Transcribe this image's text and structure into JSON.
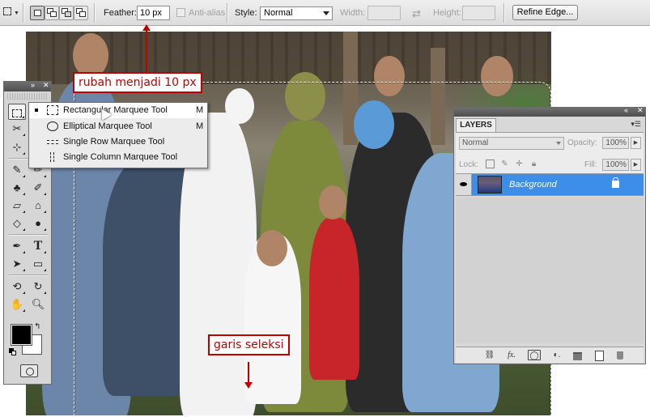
{
  "options_bar": {
    "feather_label": "Feather:",
    "feather_value": "10 px",
    "antialias_label": "Anti-alias",
    "style_label": "Style:",
    "style_value": "Normal",
    "width_label": "Width:",
    "height_label": "Height:",
    "refine_edge_label": "Refine Edge..."
  },
  "annotations": {
    "feather_note": "rubah menjadi 10 px",
    "selection_note": "garis seleksi",
    "color": "#c00000"
  },
  "tool_flyout": {
    "items": [
      {
        "label": "Rectangular Marquee Tool",
        "shortcut": "M",
        "icon": "rect-marquee-icon",
        "selected": true
      },
      {
        "label": "Elliptical Marquee Tool",
        "shortcut": "M",
        "icon": "ellipse-marquee-icon",
        "selected": false
      },
      {
        "label": "Single Row Marquee Tool",
        "shortcut": "",
        "icon": "row-marquee-icon",
        "selected": false
      },
      {
        "label": "Single Column Marquee Tool",
        "shortcut": "",
        "icon": "column-marquee-icon",
        "selected": false
      }
    ]
  },
  "tools_panel": {
    "tool_glyphs": [
      "⬚",
      "✂",
      "⊹",
      "✎",
      "♣",
      "⌂",
      "◇",
      "●",
      "✒",
      "T",
      "➤",
      "▭",
      "⚲",
      "❦",
      "✋",
      "⚲"
    ],
    "foreground_color": "#000000",
    "background_color": "#ffffff"
  },
  "layers_panel": {
    "tab_label": "LAYERS",
    "blend_mode": "Normal",
    "opacity_label": "Opacity:",
    "opacity_value": "100%",
    "lock_label": "Lock:",
    "fill_label": "Fill:",
    "fill_value": "100%",
    "layer_name": "Background",
    "selection_color": "#3d8ee8"
  }
}
